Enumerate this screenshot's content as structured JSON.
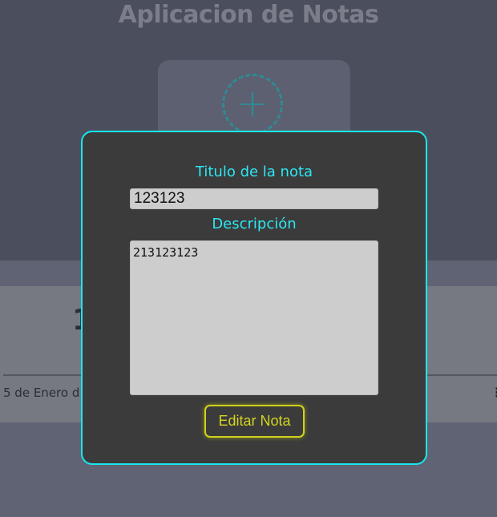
{
  "app": {
    "title": "Aplicacion de Notas",
    "add_icon": "plus-icon",
    "note": {
      "title_partial": "1",
      "date_partial": "5 de Enero d",
      "menu_icon": "more-vertical-icon"
    }
  },
  "modal": {
    "title_label": "Titulo de la nota",
    "title_value": "123123",
    "description_label": "Descripción",
    "description_value": "213123123",
    "submit_label": "Editar Nota"
  },
  "colors": {
    "accent_cyan": "#18e8ef",
    "button_yellow": "#cfd21a",
    "modal_bg": "#3b3b3b"
  }
}
